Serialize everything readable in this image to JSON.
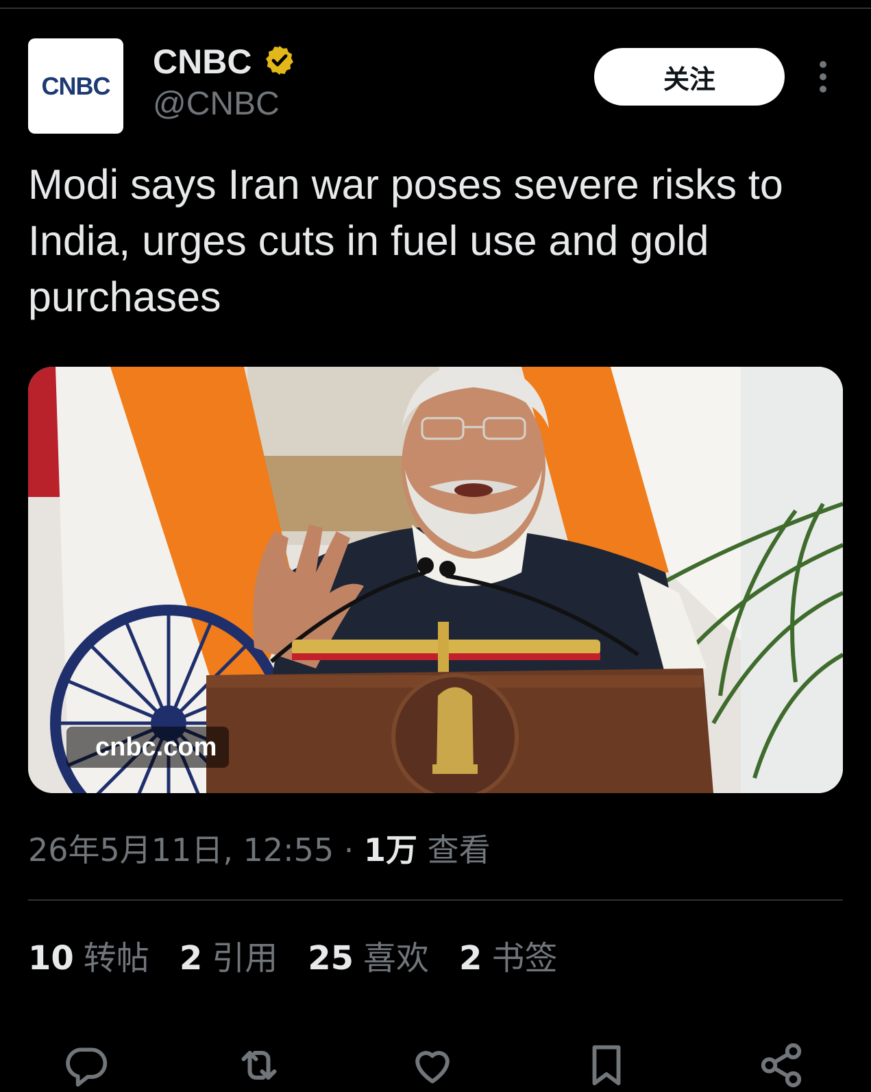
{
  "author": {
    "avatar_text": "CNBC",
    "display_name": "CNBC",
    "handle": "@CNBC",
    "verified_badge_color": "#e2b719"
  },
  "header": {
    "follow_label": "关注",
    "more_icon": "more-vertical-icon"
  },
  "tweet": {
    "text": "Modi says Iran war poses severe risks to India, urges cuts in fuel use and gold purchases"
  },
  "media": {
    "source_label": "cnbc.com"
  },
  "meta": {
    "timestamp": "26年5月11日, 12:55",
    "separator": "·",
    "views_count": "1万",
    "views_label": "查看"
  },
  "stats": [
    {
      "count": "10",
      "label": "转帖"
    },
    {
      "count": "2",
      "label": "引用"
    },
    {
      "count": "25",
      "label": "喜欢"
    },
    {
      "count": "2",
      "label": "书签"
    }
  ],
  "actions": [
    {
      "icon": "reply-icon"
    },
    {
      "icon": "retweet-icon"
    },
    {
      "icon": "like-icon"
    },
    {
      "icon": "bookmark-icon"
    },
    {
      "icon": "share-icon"
    }
  ],
  "colors": {
    "background": "#000000",
    "primary_text": "#e7e9ea",
    "secondary_text": "#71767b",
    "divider": "#2f3336",
    "follow_button_bg": "#ffffff"
  }
}
